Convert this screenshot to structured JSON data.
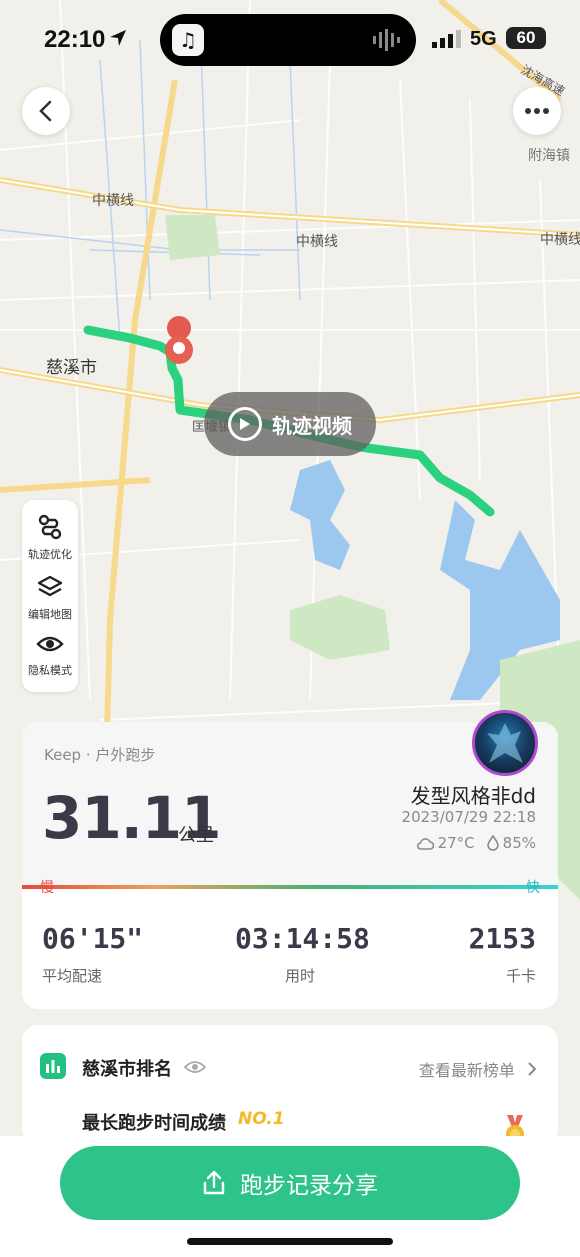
{
  "status_bar": {
    "time": "22:10",
    "network": "5G",
    "battery": "60"
  },
  "map": {
    "labels": [
      "沈海高速",
      "附海镇",
      "中横线",
      "中横线",
      "中横线",
      "慈溪市",
      "匡堰镇"
    ],
    "route_color": "#2bd17e",
    "water_color": "#9cc8ef",
    "green_color": "#cfe8c4"
  },
  "video_button": {
    "label": "轨迹视频"
  },
  "tools": [
    {
      "label": "轨迹优化",
      "icon": "route-optimize-icon"
    },
    {
      "label": "编辑地图",
      "icon": "layers-icon"
    },
    {
      "label": "隐私模式",
      "icon": "eye-icon"
    }
  ],
  "run": {
    "source": "Keep · 户外跑步",
    "distance": "31.11",
    "distance_unit": "公里",
    "username": "发型风格非dd",
    "datetime": "2023/07/29 22:18",
    "temperature": "27°C",
    "humidity": "85%",
    "slow_label": "慢",
    "fast_label": "快",
    "stats": [
      {
        "value": "06'15\"",
        "label": "平均配速"
      },
      {
        "value": "03:14:58",
        "label": "用时"
      },
      {
        "value": "2153",
        "label": "千卡"
      }
    ]
  },
  "ranking": {
    "title": "慈溪市排名",
    "link": "查看最新榜单",
    "item": "最长跑步时间成绩",
    "rank": "NO.1"
  },
  "share_button": {
    "label": "跑步记录分享"
  },
  "colors": {
    "accent": "#2ec489",
    "slow": "#e74b3c",
    "fast": "#36d4d6",
    "gold": "#f2b92a"
  }
}
